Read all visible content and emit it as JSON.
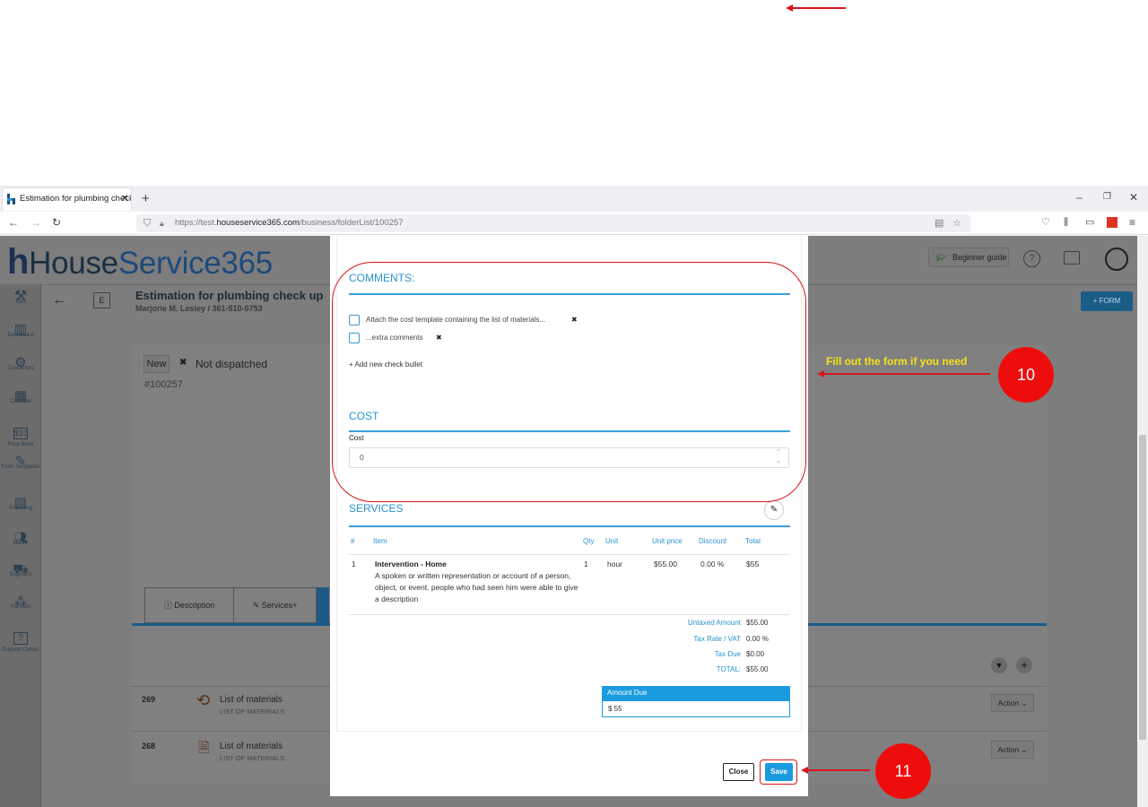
{
  "browser": {
    "tab_title": "Estimation for plumbing check",
    "url_scheme": "https://test.",
    "url_host": "houseservice365.com",
    "url_path": "/business/folderList/100257"
  },
  "app": {
    "logo_text_dark": "House",
    "logo_text_blue": "Service365",
    "beginner_guide": "Beginner guide",
    "page_title": "Estimation for plumbing check up",
    "page_subtitle": "Marjorie M. Lesley / 361-510-0753",
    "code_badge": "E",
    "form_button": "+ FORM",
    "status_new": "New",
    "status_dispatch": "Not dispatched",
    "folder_number": "#100257",
    "tab_description": "Description",
    "tab_services": "Services+",
    "rows": [
      {
        "id": "269",
        "title": "List of materials",
        "sub": "LIST OF MATERIALS",
        "action": "Action"
      },
      {
        "id": "268",
        "title": "List of materials",
        "sub": "LIST OF MATERIALS",
        "action": "Action"
      }
    ]
  },
  "sidebar": [
    {
      "label": "Jobs",
      "icon": "tools-icon"
    },
    {
      "label": "Dashboard",
      "icon": "chart-icon"
    },
    {
      "label": "Customers",
      "icon": "gear-icon"
    },
    {
      "label": "Calendar",
      "icon": "calendar-icon"
    },
    {
      "label": "Price Book",
      "icon": "price-icon"
    },
    {
      "label": "Form Templates",
      "icon": "form-icon"
    },
    {
      "label": "Reporting",
      "icon": "report-icon"
    },
    {
      "label": "Users",
      "icon": "users-icon"
    },
    {
      "label": "Suppliers",
      "icon": "truck-icon"
    },
    {
      "label": "Partners",
      "icon": "partners-icon"
    },
    {
      "label": "Support Center",
      "icon": "support-icon"
    }
  ],
  "modal": {
    "comments_title": "COMMENTS:",
    "checklist": [
      {
        "text": "Attach the cost template containing the list of materials...",
        "checked": false
      },
      {
        "text": "...extra comments",
        "checked": false
      }
    ],
    "add_bullet": "+ Add new check bullet",
    "cost_title": "COST",
    "cost_label": "Cost",
    "cost_value": "0",
    "services_title": "SERVICES",
    "table_headers": [
      "#",
      "Item",
      "Qty",
      "Unit",
      "Unit price",
      "Discount",
      "Total"
    ],
    "service_row": {
      "num": "1",
      "item": "Intervention - Home",
      "description": "A spoken or written representation or account of a person, object, or event. people who had seen him were able to give a description",
      "qty": "1",
      "unit": "hour",
      "unit_price": "$55.00",
      "discount": "0.00 %",
      "total": "$55"
    },
    "summary": [
      {
        "label": "Untaxed Amount",
        "value": "$55.00"
      },
      {
        "label": "Tax Rate / VAT",
        "value": "0.00 %"
      },
      {
        "label": "Tax Due",
        "value": "$0.00"
      },
      {
        "label": "TOTAL:",
        "value": "$55.00"
      }
    ],
    "amount_due_label": "Amount Due",
    "amount_due_value": "$ 55",
    "close_button": "Close",
    "save_button": "Save"
  },
  "annotations": {
    "step10_text": "Fill out the form if you need",
    "step10_number": "10",
    "step11_number": "11"
  },
  "colors": {
    "accent": "#2a93d0",
    "save": "#1a9be0",
    "annotation_red": "#e0161b",
    "annotation_yellow": "#f4e21c"
  }
}
